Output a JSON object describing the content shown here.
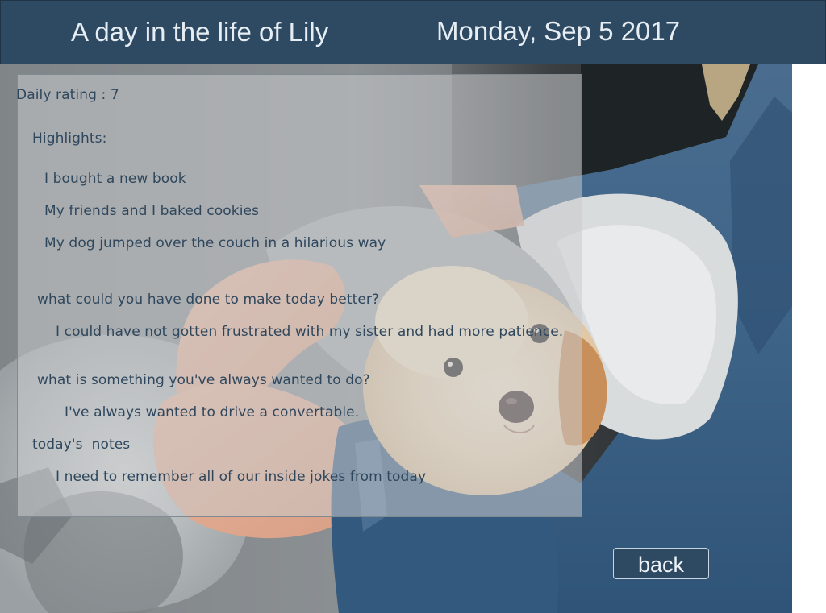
{
  "header": {
    "title": "A day in the life of Lily",
    "date": "Monday, Sep 5 2017"
  },
  "entry": {
    "daily_rating": "Daily rating : 7",
    "highlights_label": "Highlights:",
    "highlights": [
      "I bought a new book",
      "My friends and I baked cookies",
      "My dog jumped over the couch in a hilarious way"
    ],
    "question_better": "what could you have done to make today better?",
    "answer_better": "I could have not gotten frustrated with my sister and had more patience.",
    "question_always": "what is something you've always wanted to do?",
    "answer_always": "I've always wanted to drive a convertable.",
    "notes_label": "today's  notes",
    "notes": "I need to remember all of our inside jokes from today"
  },
  "back_button": {
    "label": "back"
  },
  "colors": {
    "header_bg": "#2e4a63",
    "header_text": "#e6edf3",
    "card_text": "#2f475d",
    "button_bg": "#2e4a63"
  }
}
